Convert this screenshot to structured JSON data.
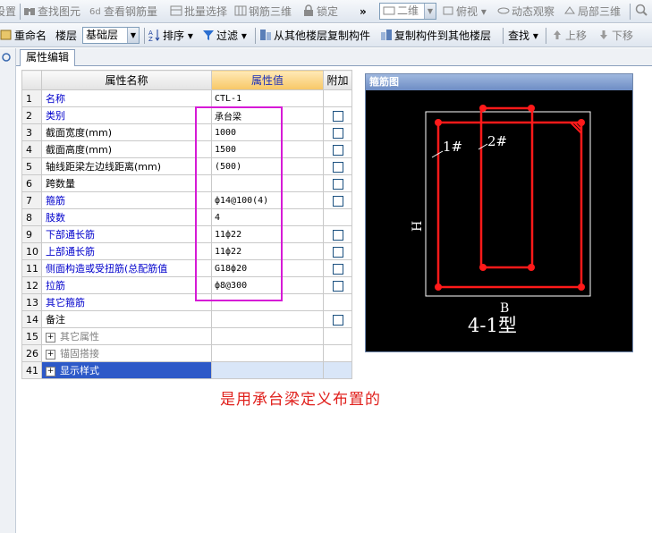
{
  "toolbar1": {
    "items": [
      "设置",
      "查找图元",
      "查看钢筋量",
      "批量选择",
      "钢筋三维",
      "锁定",
      "二维",
      "俯视",
      "动态观察",
      "局部三维"
    ]
  },
  "toolbar2": {
    "rename": "重命名",
    "floor_label": "楼层",
    "floor_value": "基础层",
    "sort": "排序",
    "filter": "过滤",
    "copy_from": "从其他楼层复制构件",
    "copy_to": "复制构件到其他楼层",
    "find": "查找",
    "move_up": "上移",
    "move_down": "下移"
  },
  "tab_label": "属性编辑",
  "grid": {
    "headers": [
      "属性名称",
      "属性值",
      "附加"
    ],
    "rows": [
      {
        "num": "1",
        "name": "名称",
        "value": "CTL-1",
        "chk": false,
        "style": "blue"
      },
      {
        "num": "2",
        "name": "类别",
        "value": "承台梁",
        "chk": true,
        "style": "blue"
      },
      {
        "num": "3",
        "name": "截面宽度(mm)",
        "value": "1000",
        "chk": true,
        "style": ""
      },
      {
        "num": "4",
        "name": "截面高度(mm)",
        "value": "1500",
        "chk": true,
        "style": ""
      },
      {
        "num": "5",
        "name": "轴线距梁左边线距离(mm)",
        "value": "(500)",
        "chk": true,
        "style": ""
      },
      {
        "num": "6",
        "name": "跨数量",
        "value": "",
        "chk": true,
        "style": ""
      },
      {
        "num": "7",
        "name": "箍筋",
        "value": "ф14@100(4)",
        "chk": true,
        "style": "blue"
      },
      {
        "num": "8",
        "name": "肢数",
        "value": "4",
        "chk": false,
        "style": "blue"
      },
      {
        "num": "9",
        "name": "下部通长筋",
        "value": "11ф22",
        "chk": true,
        "style": "blue"
      },
      {
        "num": "10",
        "name": "上部通长筋",
        "value": "11ф22",
        "chk": true,
        "style": "blue"
      },
      {
        "num": "11",
        "name": "侧面构造或受扭筋(总配筋值",
        "value": "G18ф20",
        "chk": true,
        "style": "blue"
      },
      {
        "num": "12",
        "name": "拉筋",
        "value": "ф8@300",
        "chk": true,
        "style": "blue"
      },
      {
        "num": "13",
        "name": "其它箍筋",
        "value": "",
        "chk": false,
        "style": "blue"
      },
      {
        "num": "14",
        "name": "备注",
        "value": "",
        "chk": true,
        "style": ""
      },
      {
        "num": "15",
        "name": "其它属性",
        "value": "",
        "chk": false,
        "style": "gray",
        "expand": true
      },
      {
        "num": "26",
        "name": "锚固搭接",
        "value": "",
        "chk": false,
        "style": "gray",
        "expand": true
      },
      {
        "num": "41",
        "name": "显示样式",
        "value": "",
        "chk": false,
        "style": "sel",
        "expand": true
      }
    ]
  },
  "rebar_panel": {
    "title": "箍筋图",
    "label_1": "1#",
    "label_2": "2#",
    "label_h": "H",
    "label_b": "B",
    "type_label": "4-1型"
  },
  "note": "是用承台梁定义布置的",
  "colors": {
    "rebar": "#ff1a1a",
    "highlight_box": "#d61ad6",
    "note": "#e0201c"
  }
}
